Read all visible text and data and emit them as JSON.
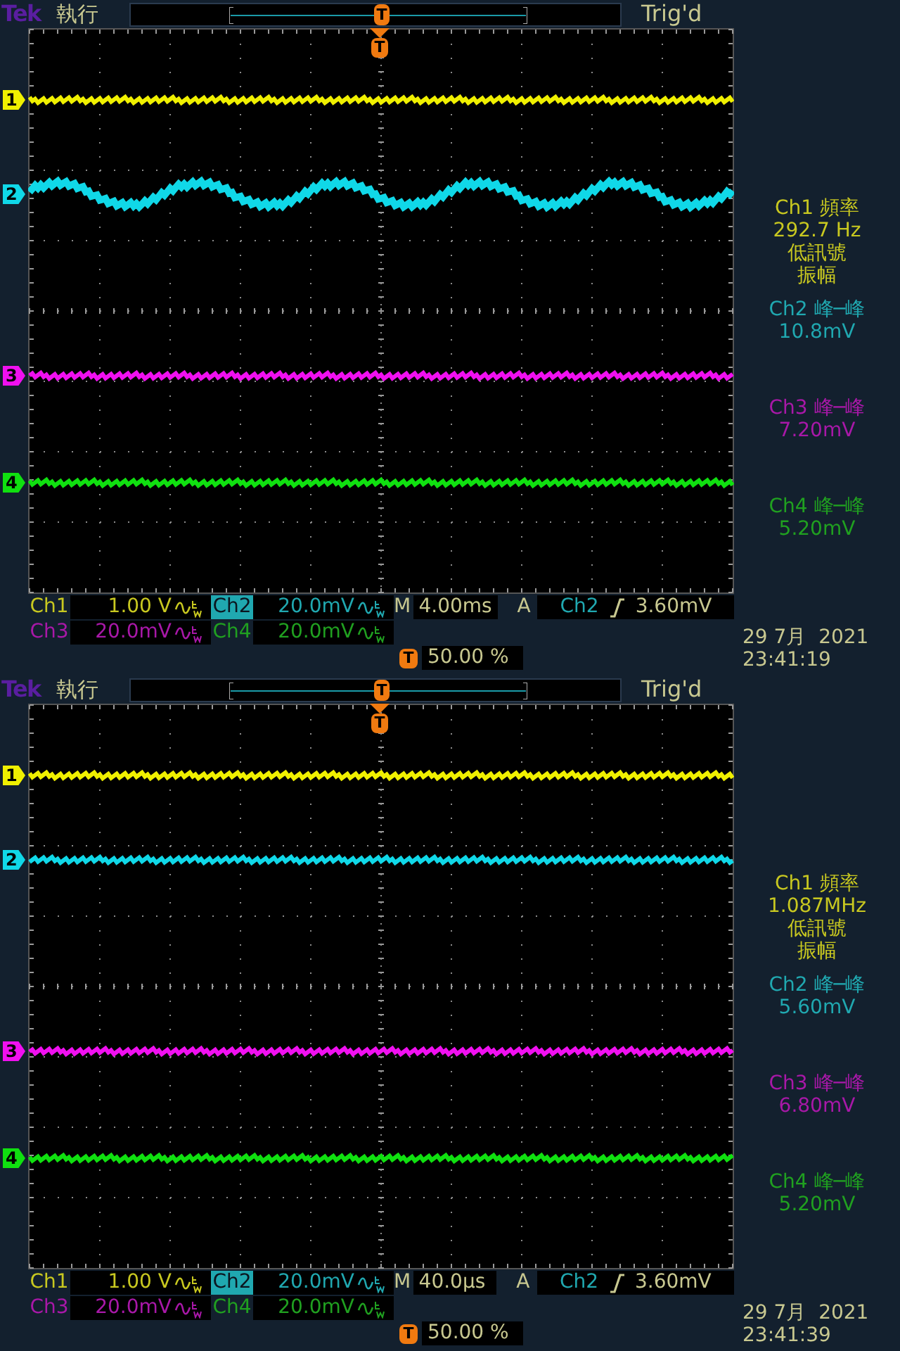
{
  "scopes": [
    {
      "brand": "Tek",
      "run_state": "執行",
      "record_marker": "T",
      "trigger_status": "Trig'd",
      "trigger_marker": "T",
      "channels": [
        {
          "marker": "1",
          "color": "#f0f000",
          "kind": "flat"
        },
        {
          "marker": "2",
          "color": "#10d8e8",
          "kind": "sine"
        },
        {
          "marker": "3",
          "color": "#f010f0",
          "kind": "flat"
        },
        {
          "marker": "4",
          "color": "#10e010",
          "kind": "flat"
        }
      ],
      "measurements": [
        {
          "lines": [
            "Ch1 頻率",
            "292.7 Hz",
            "低訊號",
            "振幅"
          ],
          "color": "#c8c820"
        },
        {
          "lines": [
            "Ch2 峰─峰",
            "10.8mV"
          ],
          "color": "#20a8b0"
        },
        {
          "lines": [
            "Ch3 峰─峰",
            "7.20mV"
          ],
          "color": "#a818a8"
        },
        {
          "lines": [
            "Ch4 峰─峰",
            "5.20mV"
          ],
          "color": "#20a020"
        }
      ],
      "vertical": [
        {
          "label": "Ch1",
          "scale": "1.00 V",
          "selected": false,
          "color": "#c8c820"
        },
        {
          "label": "Ch2",
          "scale": "20.0mV",
          "selected": true,
          "color": "#20a8b0"
        },
        {
          "label": "Ch3",
          "scale": "20.0mV",
          "selected": false,
          "color": "#a818a8"
        },
        {
          "label": "Ch4",
          "scale": "20.0mV",
          "selected": false,
          "color": "#20a020"
        }
      ],
      "timebase": {
        "label": "M",
        "value": "4.00ms"
      },
      "trigger": {
        "mode": "A",
        "source": "Ch2",
        "level": "3.60mV"
      },
      "trigger_position": {
        "marker": "T",
        "value": "50.00 %"
      },
      "date": "29 7月  2021",
      "time": "23:41:19"
    },
    {
      "brand": "Tek",
      "run_state": "執行",
      "record_marker": "T",
      "trigger_status": "Trig'd",
      "trigger_marker": "T",
      "channels": [
        {
          "marker": "1",
          "color": "#f0f000",
          "kind": "flat"
        },
        {
          "marker": "2",
          "color": "#10d8e8",
          "kind": "flat"
        },
        {
          "marker": "3",
          "color": "#f010f0",
          "kind": "flat"
        },
        {
          "marker": "4",
          "color": "#10e010",
          "kind": "flat"
        }
      ],
      "measurements": [
        {
          "lines": [
            "Ch1 頻率",
            "1.087MHz",
            "低訊號",
            "振幅"
          ],
          "color": "#c8c820"
        },
        {
          "lines": [
            "Ch2 峰─峰",
            "5.60mV"
          ],
          "color": "#20a8b0"
        },
        {
          "lines": [
            "Ch3 峰─峰",
            "6.80mV"
          ],
          "color": "#a818a8"
        },
        {
          "lines": [
            "Ch4 峰─峰",
            "5.20mV"
          ],
          "color": "#20a020"
        }
      ],
      "vertical": [
        {
          "label": "Ch1",
          "scale": "1.00 V",
          "selected": false,
          "color": "#c8c820"
        },
        {
          "label": "Ch2",
          "scale": "20.0mV",
          "selected": true,
          "color": "#20a8b0"
        },
        {
          "label": "Ch3",
          "scale": "20.0mV",
          "selected": false,
          "color": "#a818a8"
        },
        {
          "label": "Ch4",
          "scale": "20.0mV",
          "selected": false,
          "color": "#20a020"
        }
      ],
      "timebase": {
        "label": "M",
        "value": "40.0µs"
      },
      "trigger": {
        "mode": "A",
        "source": "Ch2",
        "level": "3.60mV"
      },
      "trigger_position": {
        "marker": "T",
        "value": "50.00 %"
      },
      "date": "29 7月  2021",
      "time": "23:41:39"
    }
  ]
}
